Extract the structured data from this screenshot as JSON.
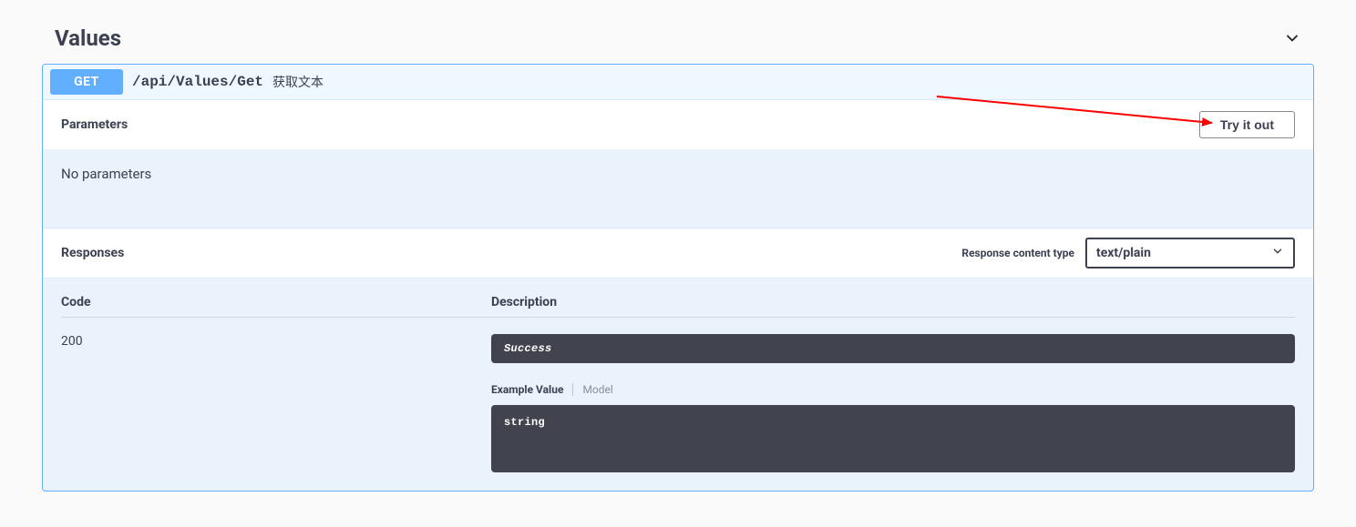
{
  "section": {
    "title": "Values"
  },
  "op": {
    "method": "GET",
    "path": "/api/Values/Get",
    "summary": "获取文本"
  },
  "parameters": {
    "heading": "Parameters",
    "try_label": "Try it out",
    "empty": "No parameters"
  },
  "responses": {
    "heading": "Responses",
    "content_type_label": "Response content type",
    "content_type_value": "text/plain",
    "col_code": "Code",
    "col_desc": "Description",
    "rows": [
      {
        "code": "200",
        "message": "Success",
        "example_label": "Example Value",
        "model_label": "Model",
        "example_body": "string"
      }
    ]
  }
}
